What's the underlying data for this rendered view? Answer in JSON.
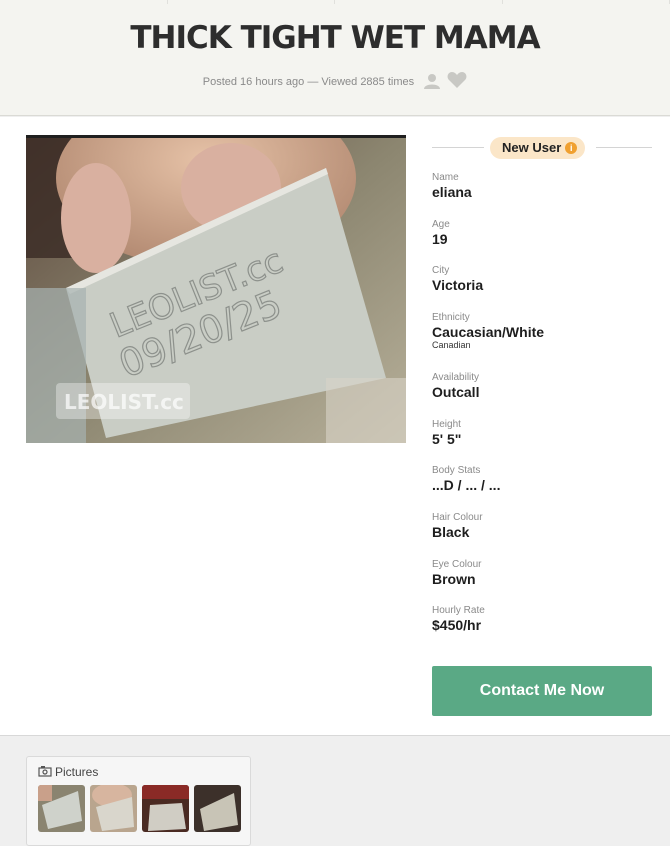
{
  "header": {
    "title": "THICK TIGHT WET MAMA",
    "posted": "Posted 16 hours ago — Viewed 2885 times",
    "icons": [
      "user-icon",
      "heart-icon"
    ]
  },
  "photo": {
    "watermark_text": "LEOLIST.cc",
    "sign_line1": "LEOLIST.cc",
    "sign_line2": "09/20/25"
  },
  "profile": {
    "badge": "New User",
    "fields": [
      {
        "label": "Name",
        "value": "eliana"
      },
      {
        "label": "Age",
        "value": "19"
      },
      {
        "label": "City",
        "value": "Victoria"
      },
      {
        "label": "Ethnicity",
        "value": "Caucasian/White",
        "sub": "Canadian"
      },
      {
        "label": "Availability",
        "value": "Outcall"
      },
      {
        "label": "Height",
        "value": "5' 5\""
      },
      {
        "label": "Body Stats",
        "value": "...D / ... / ..."
      },
      {
        "label": "Hair Colour",
        "value": "Black"
      },
      {
        "label": "Eye Colour",
        "value": "Brown"
      },
      {
        "label": "Hourly Rate",
        "value": "$450/hr"
      }
    ]
  },
  "contact_label": "Contact Me Now",
  "pictures": {
    "heading": "Pictures",
    "count": 4
  },
  "colors": {
    "accent": "#5aa985",
    "badge_bg": "#fbe6c8",
    "badge_icon": "#f0a030"
  }
}
